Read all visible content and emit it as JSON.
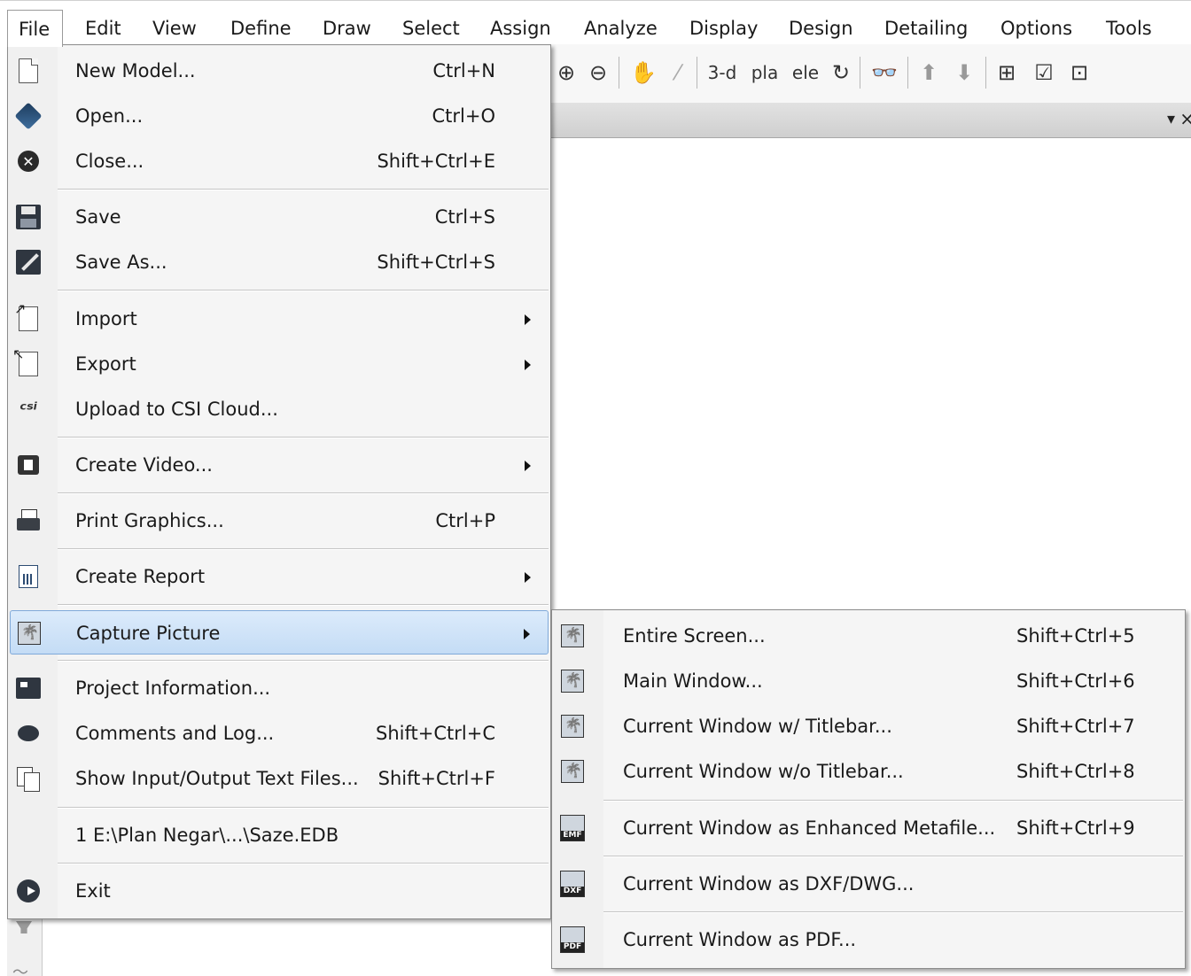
{
  "menubar": {
    "items": [
      "File",
      "Edit",
      "View",
      "Define",
      "Draw",
      "Select",
      "Assign",
      "Analyze",
      "Display",
      "Design",
      "Detailing",
      "Options",
      "Tools"
    ]
  },
  "toolbar": {
    "three_d": "3-d",
    "plan": "pla",
    "elev": "ele",
    "dropdown_glyph": "▾",
    "close_glyph": "×"
  },
  "file_menu": {
    "items": [
      {
        "label": "New Model...",
        "shortcut": "Ctrl+N",
        "icon": "new-document-icon"
      },
      {
        "label": "Open...",
        "shortcut": "Ctrl+O",
        "icon": "open-icon"
      },
      {
        "label": "Close...",
        "shortcut": "Shift+Ctrl+E",
        "icon": "close-icon"
      },
      {
        "label": "Save",
        "shortcut": "Ctrl+S",
        "icon": "save-icon"
      },
      {
        "label": "Save As...",
        "shortcut": "Shift+Ctrl+S",
        "icon": "save-as-icon"
      },
      {
        "label": "Import",
        "shortcut": "",
        "icon": "import-icon",
        "submenu": true
      },
      {
        "label": "Export",
        "shortcut": "",
        "icon": "export-icon",
        "submenu": true
      },
      {
        "label": "Upload to CSI Cloud...",
        "shortcut": "",
        "icon": "csi-cloud-icon"
      },
      {
        "label": "Create Video...",
        "shortcut": "",
        "icon": "video-icon",
        "submenu": true
      },
      {
        "label": "Print Graphics...",
        "shortcut": "Ctrl+P",
        "icon": "printer-icon"
      },
      {
        "label": "Create Report",
        "shortcut": "",
        "icon": "report-icon",
        "submenu": true
      },
      {
        "label": "Capture Picture",
        "shortcut": "",
        "icon": "picture-icon",
        "submenu": true,
        "highlighted": true
      },
      {
        "label": "Project Information...",
        "shortcut": "",
        "icon": "project-info-icon"
      },
      {
        "label": "Comments and Log...",
        "shortcut": "Shift+Ctrl+C",
        "icon": "comment-icon"
      },
      {
        "label": "Show Input/Output Text Files...",
        "shortcut": "Shift+Ctrl+F",
        "icon": "text-files-icon"
      },
      {
        "label": "1 E:\\Plan Negar\\...\\Saze.EDB",
        "shortcut": "",
        "icon": ""
      },
      {
        "label": "Exit",
        "shortcut": "",
        "icon": "exit-icon"
      }
    ]
  },
  "capture_menu": {
    "items": [
      {
        "label": "Entire Screen...",
        "shortcut": "Shift+Ctrl+5",
        "icon": "entire-screen-icon"
      },
      {
        "label": "Main Window...",
        "shortcut": "Shift+Ctrl+6",
        "icon": "main-window-icon"
      },
      {
        "label": "Current Window w/ Titlebar...",
        "shortcut": "Shift+Ctrl+7",
        "icon": "window-titlebar-icon"
      },
      {
        "label": "Current Window w/o Titlebar...",
        "shortcut": "Shift+Ctrl+8",
        "icon": "window-no-titlebar-icon"
      },
      {
        "label": "Current Window as Enhanced Metafile...",
        "shortcut": "Shift+Ctrl+9",
        "icon": "emf-icon",
        "badge": "EMF"
      },
      {
        "label": "Current Window as DXF/DWG...",
        "shortcut": "",
        "icon": "dxf-icon",
        "badge": "DXF"
      },
      {
        "label": "Current Window as PDF...",
        "shortcut": "",
        "icon": "pdf-icon",
        "badge": "PDF"
      }
    ]
  },
  "colors": {
    "highlight_top": "#dcebfb",
    "highlight_bottom": "#c4dcf5",
    "highlight_border": "#7fa9d9",
    "menu_bg": "#f5f5f5"
  }
}
